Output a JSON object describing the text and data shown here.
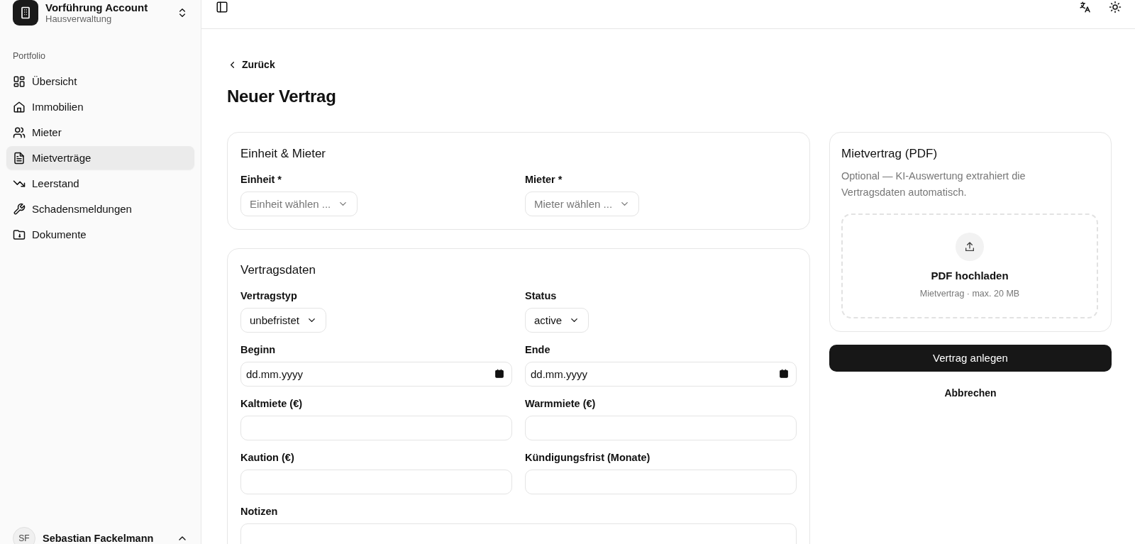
{
  "account": {
    "name": "Vorführung Account",
    "subtitle": "Hausverwaltung"
  },
  "sidebar": {
    "section": "Portfolio",
    "items": [
      {
        "label": "Übersicht",
        "selected": false
      },
      {
        "label": "Immobilien",
        "selected": false
      },
      {
        "label": "Mieter",
        "selected": false
      },
      {
        "label": "Mietverträge",
        "selected": true
      },
      {
        "label": "Leerstand",
        "selected": false
      },
      {
        "label": "Schadensmeldungen",
        "selected": false
      },
      {
        "label": "Dokumente",
        "selected": false
      }
    ]
  },
  "user": {
    "initials": "SF",
    "name": "Sebastian Fackelmann"
  },
  "back_link": "Zurück",
  "title": "Neuer Vertrag",
  "cards": [
    {
      "title": "Einheit & Mieter",
      "fields": [
        {
          "kind": "select",
          "label": "Einheit *",
          "placeholder": "Einheit wählen ..."
        },
        {
          "kind": "select",
          "label": "Mieter *",
          "placeholder": "Mieter wählen ..."
        }
      ]
    },
    {
      "title": "Vertragsdaten",
      "fields": [
        {
          "kind": "select",
          "label": "Vertragstyp",
          "value": "unbefristet"
        },
        {
          "kind": "select",
          "label": "Status",
          "value": "active"
        },
        {
          "kind": "date",
          "label": "Beginn",
          "placeholder": "dd.mm.yyyy"
        },
        {
          "kind": "date",
          "label": "Ende",
          "placeholder": "dd.mm.yyyy"
        },
        {
          "kind": "text",
          "label": "Kaltmiete (€)"
        },
        {
          "kind": "text",
          "label": "Warmmiete (€)"
        },
        {
          "kind": "text",
          "label": "Kaution (€)"
        },
        {
          "kind": "text",
          "label": "Kündigungsfrist (Monate)"
        },
        {
          "kind": "textarea",
          "label": "Notizen"
        }
      ]
    }
  ],
  "upload_card": {
    "title": "Mietvertrag (PDF)",
    "description": "Optional — KI-Auswertung extrahiert die Vertragsdaten automatisch.",
    "drop_title": "PDF hochladen",
    "drop_hint": "Mietvertrag · max. 20 MB"
  },
  "buttons": {
    "primary": "Vertrag anlegen",
    "secondary": "Abbrechen"
  }
}
